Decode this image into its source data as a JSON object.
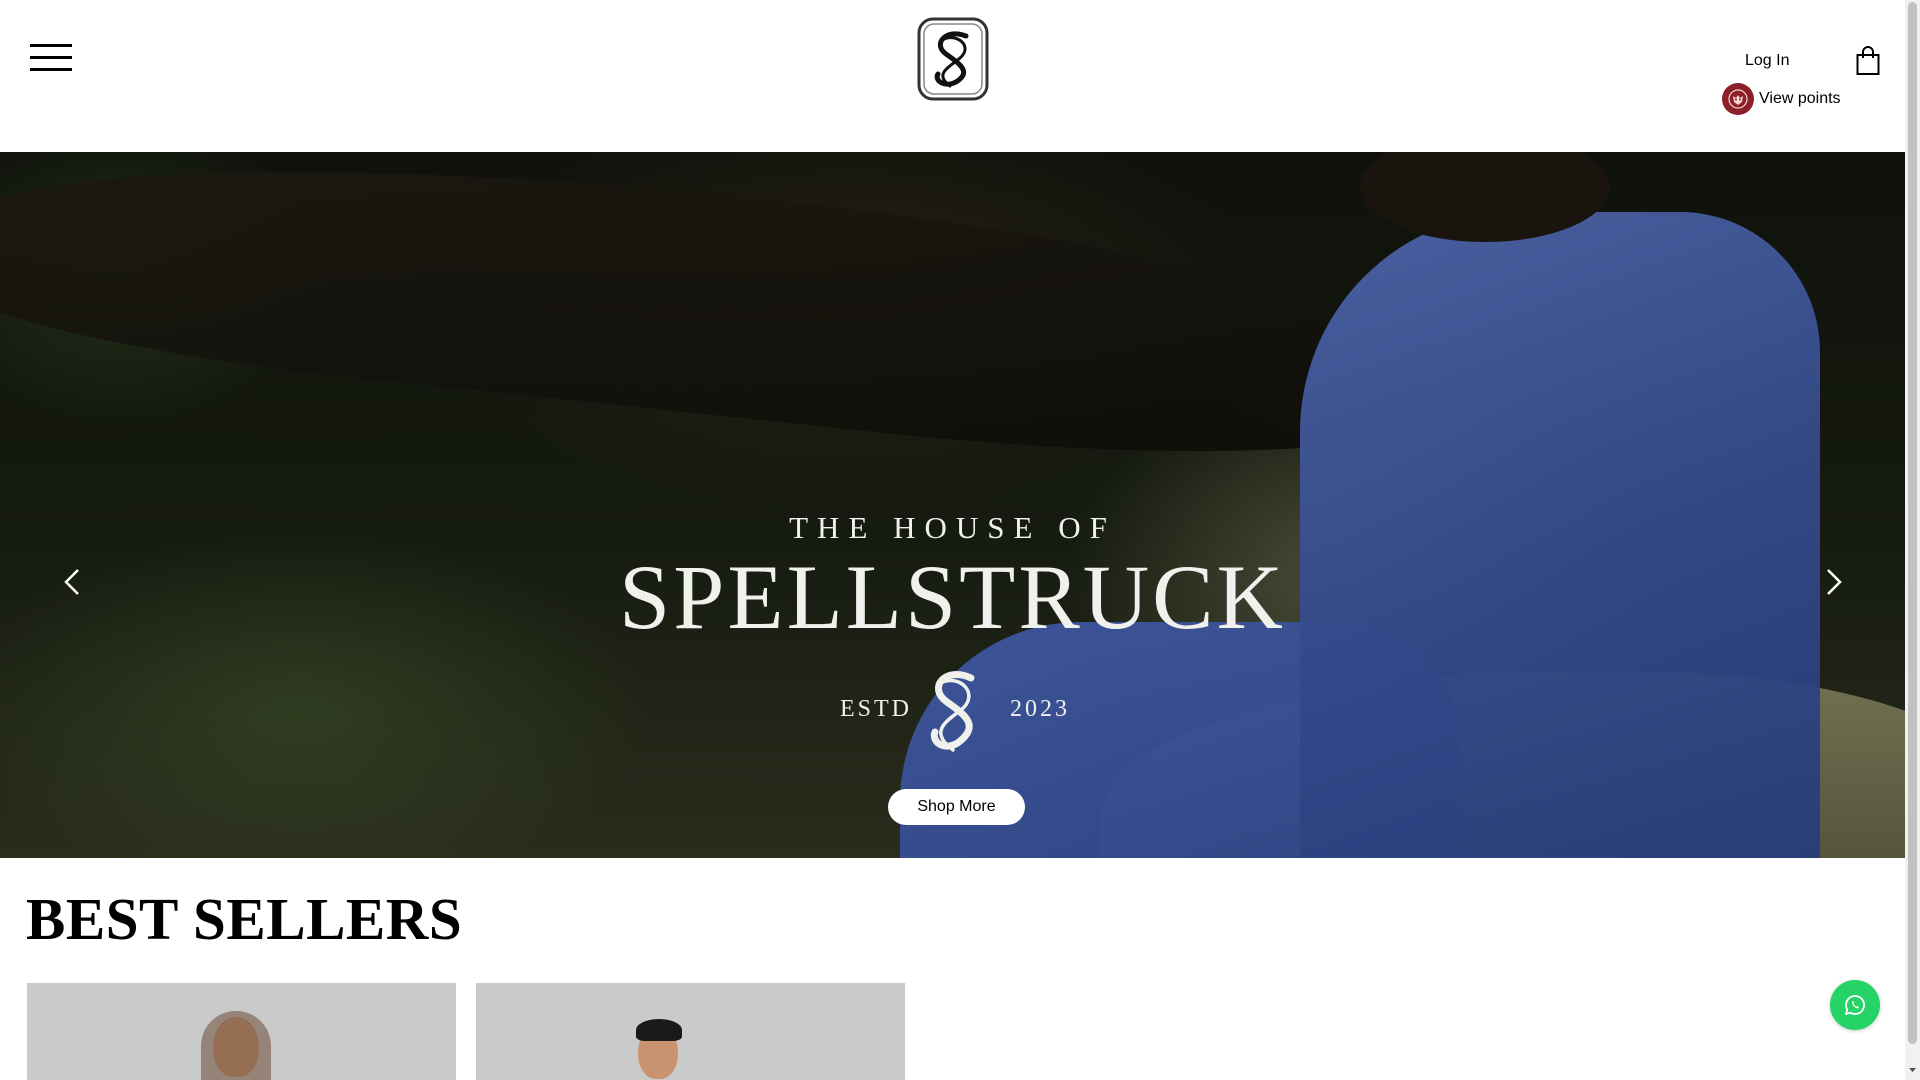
{
  "header": {
    "menu_icon": "hamburger-menu-icon",
    "logo_icon": "spellstruck-monogram-logo",
    "login_label": "Log In",
    "points_label": "View points",
    "points_icon": "tiger-badge-icon",
    "cart_icon": "shopping-bag-icon"
  },
  "hero": {
    "tagline": "THE HOUSE OF",
    "brand": "SPELLSTRUCK",
    "estd_label": "ESTD",
    "estd_year": "2023",
    "prev_icon": "chevron-left-icon",
    "next_icon": "chevron-right-icon",
    "cta_label": "Shop More"
  },
  "best_sellers": {
    "title": "BEST SELLERS"
  },
  "floating": {
    "whatsapp_icon": "whatsapp-icon"
  },
  "colors": {
    "brand_badge": "#8c1f2a",
    "whatsapp_green": "#25d366",
    "card_bg": "#cacaca"
  }
}
